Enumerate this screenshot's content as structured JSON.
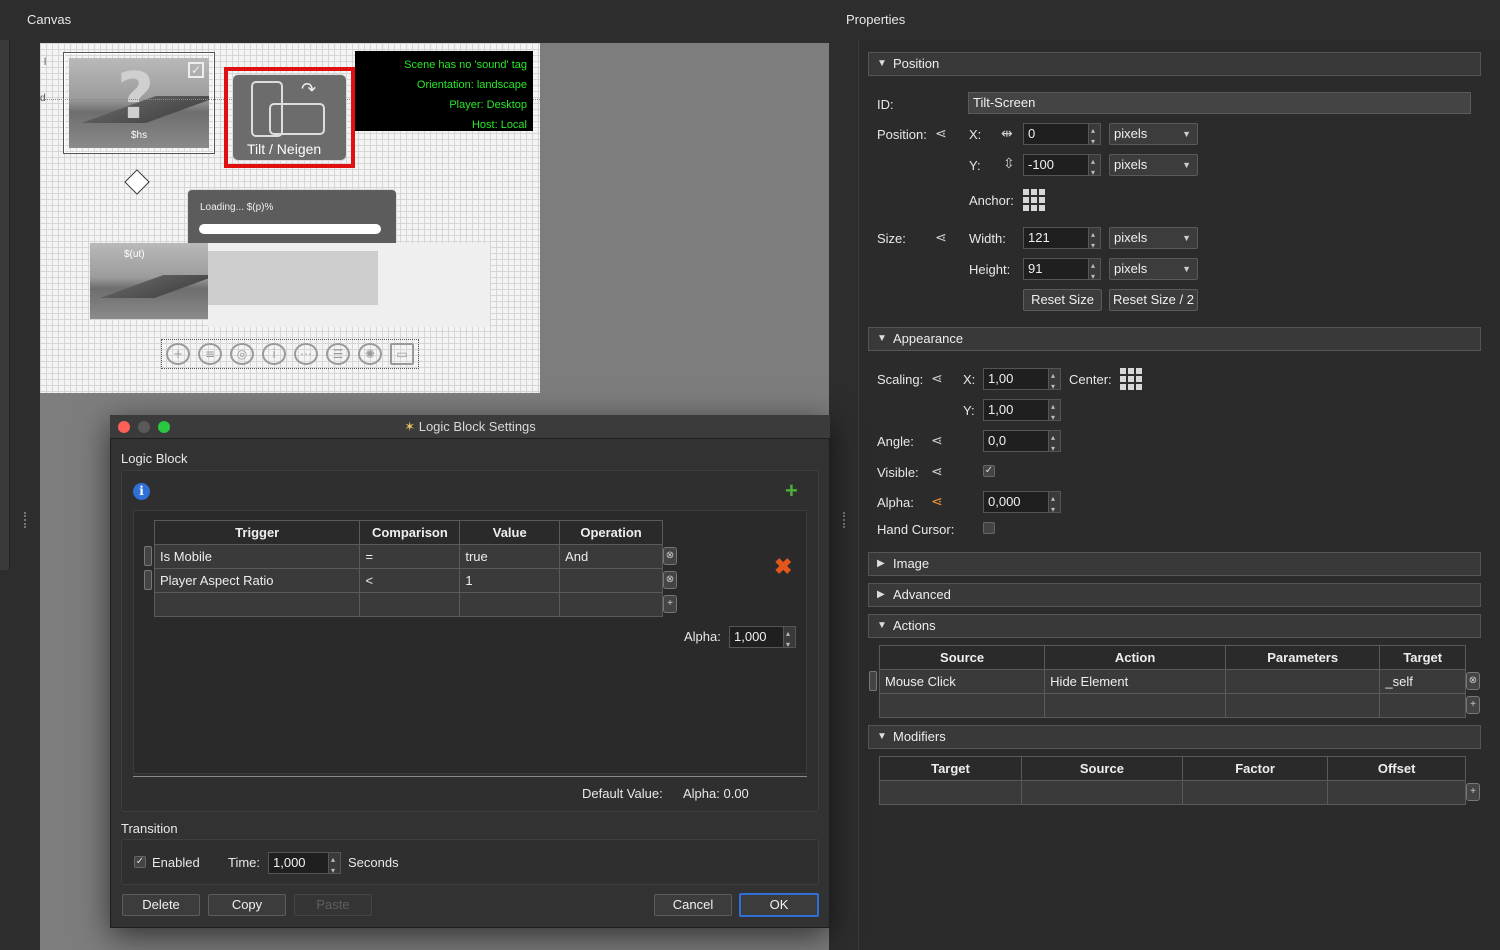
{
  "panels": {
    "canvas_title": "Canvas",
    "properties_title": "Properties"
  },
  "scene": {
    "info_lines": [
      "Scene has no 'sound' tag",
      "Orientation: landscape",
      "Player: Desktop",
      "Host: Local"
    ],
    "thumb1_label": "$hs",
    "tilt_label": "Tilt / Neigen",
    "loading_text": "Loading... $(p)%",
    "thumb2_label": "$(ut)",
    "side_label_1": "d",
    "side_label_2": "l",
    "toolbar_icons": [
      "add-circle-icon",
      "menu-circle-icon",
      "hotspot-circle-icon",
      "info-circle-icon",
      "dots-circle-icon",
      "list-circle-icon",
      "swirl-circle-icon",
      "window-icon"
    ]
  },
  "properties": {
    "position": {
      "header": "Position",
      "id_label": "ID:",
      "id_value": "Tilt-Screen",
      "position_label": "Position:",
      "x_label": "X:",
      "x_value": "0",
      "x_unit": "pixels",
      "y_label": "Y:",
      "y_value": "-100",
      "y_unit": "pixels",
      "anchor_label": "Anchor:",
      "size_label": "Size:",
      "width_label": "Width:",
      "width_value": "121",
      "width_unit": "pixels",
      "height_label": "Height:",
      "height_value": "91",
      "height_unit": "pixels",
      "reset_size": "Reset Size",
      "reset_size_half": "Reset Size / 2"
    },
    "appearance": {
      "header": "Appearance",
      "scaling_label": "Scaling:",
      "x_label": "X:",
      "scale_x": "1,00",
      "center_label": "Center:",
      "y_label": "Y:",
      "scale_y": "1,00",
      "angle_label": "Angle:",
      "angle_value": "0,0",
      "visible_label": "Visible:",
      "visible_checked": true,
      "alpha_label": "Alpha:",
      "alpha_value": "0,000",
      "hand_cursor_label": "Hand Cursor:",
      "hand_cursor_checked": false
    },
    "image": {
      "header": "Image"
    },
    "advanced": {
      "header": "Advanced"
    },
    "actions": {
      "header": "Actions",
      "columns": [
        "Source",
        "Action",
        "Parameters",
        "Target"
      ],
      "rows": [
        [
          "Mouse Click",
          "Hide Element",
          "",
          "_self"
        ]
      ]
    },
    "modifiers": {
      "header": "Modifiers",
      "columns": [
        "Target",
        "Source",
        "Factor",
        "Offset"
      ]
    }
  },
  "dialog": {
    "title": "Logic Block Settings",
    "group_label": "Logic Block",
    "columns": [
      "Trigger",
      "Comparison",
      "Value",
      "Operation"
    ],
    "rows": [
      [
        "Is Mobile",
        "=",
        "true",
        "And"
      ],
      [
        "Player Aspect Ratio",
        "<",
        "1",
        ""
      ]
    ],
    "alpha_label": "Alpha:",
    "alpha_value": "1,000",
    "default_value_label": "Default Value:",
    "default_value": "Alpha:  0.00",
    "transition_label": "Transition",
    "enabled_label": "Enabled",
    "time_label": "Time:",
    "time_value": "1,000",
    "seconds_label": "Seconds",
    "delete": "Delete",
    "copy": "Copy",
    "paste": "Paste",
    "cancel": "Cancel",
    "ok": "OK"
  },
  "colors": {
    "accent_blue": "#2f6fd6",
    "delete_x": "#e2561d",
    "add_plus": "#4caf3a",
    "info_text": "#27e827",
    "selection_red": "#e01010"
  }
}
